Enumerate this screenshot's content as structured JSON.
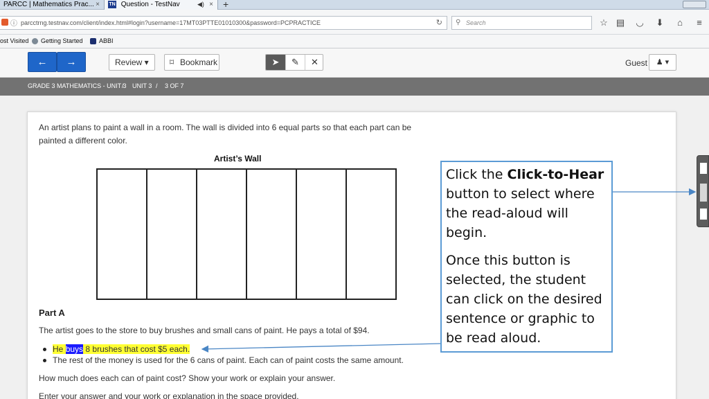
{
  "browser": {
    "tabs": [
      {
        "label": "PARCC | Mathematics Prac...",
        "close": "×"
      },
      {
        "label": "Question - TestNav",
        "favicon": "TN",
        "close": "×"
      }
    ],
    "new_tab": "+",
    "url": "parcctrng.testnav.com/client/index.html#login?username=17MT03PTTE01010300&password=PCPRACTICE",
    "search_placeholder": "Search",
    "bookmarks": [
      "ost Visited",
      "Getting Started",
      "ABBI"
    ]
  },
  "toolbar": {
    "review_label": "Review ▾",
    "bookmark_label": "Bookmark",
    "guest_label": "Guest",
    "user_menu": "♟ ▾"
  },
  "breadcrumb": {
    "items": [
      "GRADE 3 MATHEMATICS - UNIT 3",
      "/",
      "UNIT 3",
      "/",
      "3 OF 7"
    ]
  },
  "question": {
    "intro_line1": "An artist plans to paint a wall in a room. The wall is divided into 6 equal parts so that each part can be",
    "intro_line2": "painted a different color.",
    "wall_title": "Artist’s Wall",
    "part_a": "Part A",
    "part_a_text": "The artist goes to the store to buy brushes and small cans of paint. He pays a total of $94.",
    "bullet1_w1": "He",
    "bullet1_w2": "buys",
    "bullet1_rest": "8 brushes that cost $5 each.",
    "bullet2": "The rest of the money is used for the 6 cans of paint. Each can of paint costs the same amount.",
    "prompt": "How much does each can of paint cost? Show your work or explain your answer.",
    "instruction": "Enter your answer and your work or explanation in the space provided."
  },
  "callout": {
    "p1_pre": "Click the ",
    "p1_bold": "Click-to-Hear",
    "p1_post": " button to select where the read-aloud will begin.",
    "p2": "Once this button is selected, the student can click on the desired sentence or graphic to be read aloud."
  },
  "colors": {
    "nav_button": "#1f66c9",
    "breadcrumb_band": "#727272",
    "callout_border": "#5b9bd5",
    "highlight": "#ffff33",
    "selected_word": "#1a1aff"
  }
}
